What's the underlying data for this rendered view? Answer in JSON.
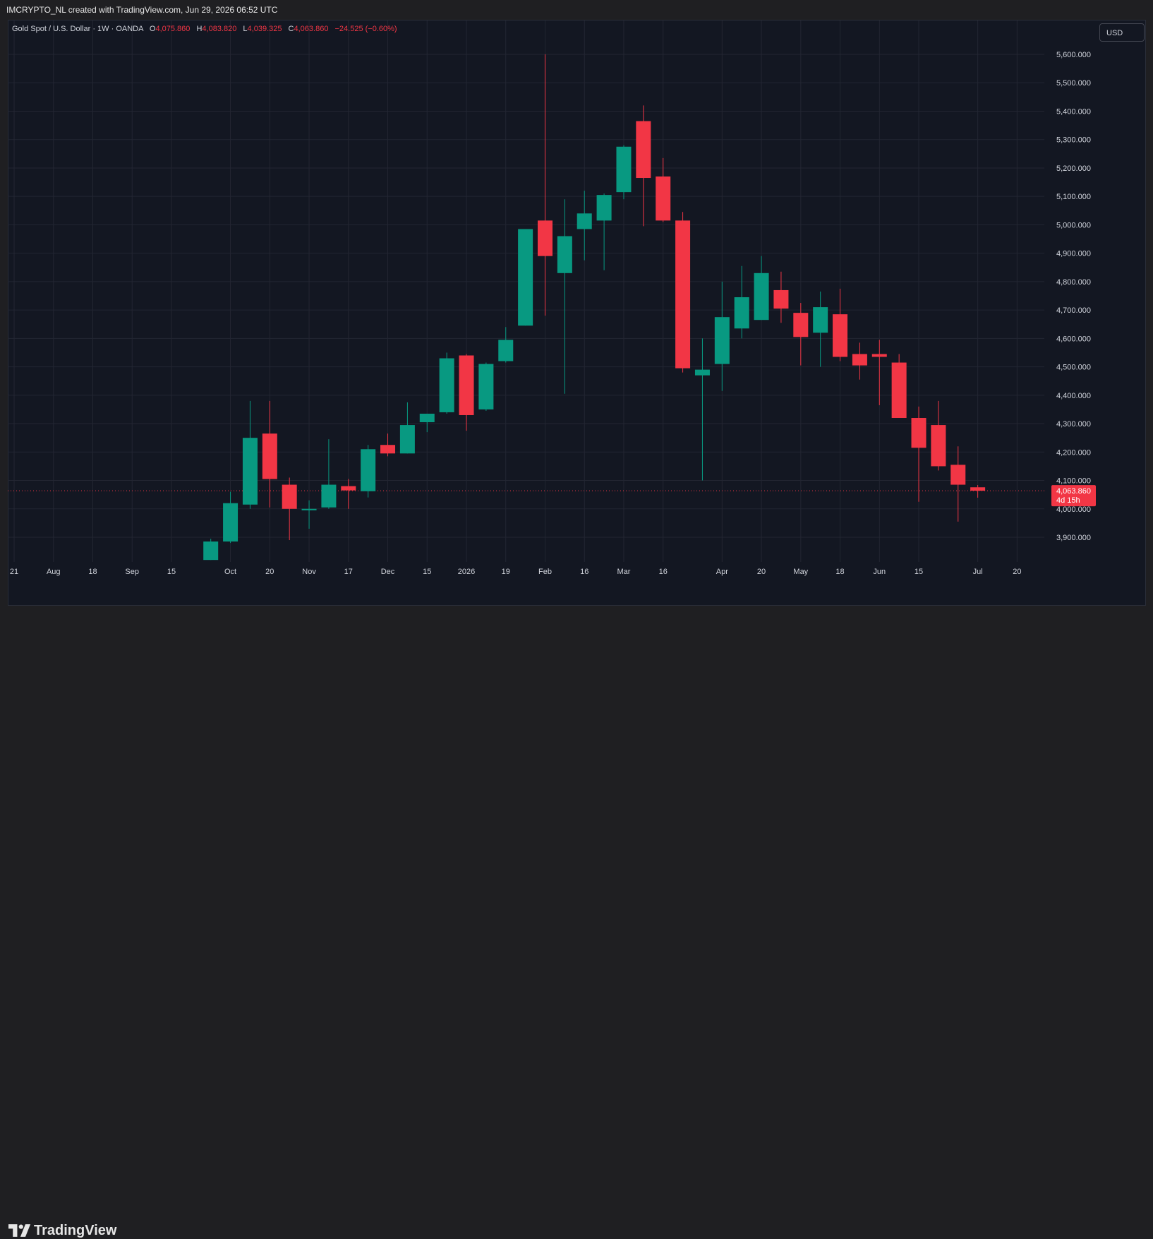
{
  "header": {
    "created_text": "IMCRYPTO_NL created with TradingView.com, Jun 29, 2026 06:52 UTC"
  },
  "legend": {
    "symbol": "Gold Spot / U.S. Dollar · 1W · OANDA",
    "open_label": "O",
    "open_value": "4,075.860",
    "high_label": "H",
    "high_value": "4,083.820",
    "low_label": "L",
    "low_value": "4,039.325",
    "close_label": "C",
    "close_value": "4,063.860",
    "change": "−24.525 (−0.60%)"
  },
  "currency_button": "USD",
  "price_tag": {
    "price": "4,063.860",
    "countdown": "4d 15h"
  },
  "footer": {
    "brand": "TradingView",
    "logo": "tradingview-logo-icon"
  },
  "colors": {
    "up": "#089981",
    "down": "#f23645",
    "background": "#131722",
    "grid": "#232632",
    "text": "#d1d4dc",
    "price_line": "#f23645"
  },
  "chart_data": {
    "type": "candlestick",
    "interval": "1W",
    "ylim": [
      3800,
      5700
    ],
    "y_ticks": [
      3900,
      4000,
      4100,
      4200,
      4300,
      4400,
      4500,
      4600,
      4700,
      4800,
      4900,
      5000,
      5100,
      5200,
      5300,
      5400,
      5500,
      5600
    ],
    "y_tick_labels": [
      "3,900.000",
      "4,000.000",
      "4,100.000",
      "4,200.000",
      "4,300.000",
      "4,400.000",
      "4,500.000",
      "4,600.000",
      "4,700.000",
      "4,800.000",
      "4,900.000",
      "5,000.000",
      "5,100.000",
      "5,200.000",
      "5,300.000",
      "5,400.000",
      "5,500.000",
      "5,600.000"
    ],
    "x_ticks": [
      {
        "label": "21",
        "week": -10
      },
      {
        "label": "Aug",
        "week": -8
      },
      {
        "label": "18",
        "week": -6
      },
      {
        "label": "Sep",
        "week": -4
      },
      {
        "label": "15",
        "week": -2
      },
      {
        "label": "Oct",
        "week": 1
      },
      {
        "label": "20",
        "week": 3
      },
      {
        "label": "Nov",
        "week": 5
      },
      {
        "label": "17",
        "week": 7
      },
      {
        "label": "Dec",
        "week": 9
      },
      {
        "label": "15",
        "week": 11
      },
      {
        "label": "2026",
        "week": 13
      },
      {
        "label": "19",
        "week": 15
      },
      {
        "label": "Feb",
        "week": 17
      },
      {
        "label": "16",
        "week": 19
      },
      {
        "label": "Mar",
        "week": 21
      },
      {
        "label": "16",
        "week": 23
      },
      {
        "label": "Apr",
        "week": 26
      },
      {
        "label": "20",
        "week": 28
      },
      {
        "label": "May",
        "week": 30
      },
      {
        "label": "18",
        "week": 32
      },
      {
        "label": "Jun",
        "week": 34
      },
      {
        "label": "15",
        "week": 36
      },
      {
        "label": "Jul",
        "week": 39
      },
      {
        "label": "20",
        "week": 41
      }
    ],
    "last_price": 4063.86,
    "candles": [
      {
        "o": 3820,
        "h": 3895,
        "l": 3820,
        "c": 3885
      },
      {
        "o": 3885,
        "h": 4060,
        "l": 3880,
        "c": 4020
      },
      {
        "o": 4015,
        "h": 4380,
        "l": 4000,
        "c": 4250
      },
      {
        "o": 4265,
        "h": 4380,
        "l": 4005,
        "c": 4105
      },
      {
        "o": 4085,
        "h": 4110,
        "l": 3890,
        "c": 4000
      },
      {
        "o": 3995,
        "h": 4030,
        "l": 3930,
        "c": 4000
      },
      {
        "o": 4005,
        "h": 4245,
        "l": 4000,
        "c": 4085
      },
      {
        "o": 4080,
        "h": 4105,
        "l": 4000,
        "c": 4065
      },
      {
        "o": 4062,
        "h": 4225,
        "l": 4040,
        "c": 4210
      },
      {
        "o": 4225,
        "h": 4265,
        "l": 4185,
        "c": 4195
      },
      {
        "o": 4195,
        "h": 4375,
        "l": 4195,
        "c": 4295
      },
      {
        "o": 4305,
        "h": 4335,
        "l": 4270,
        "c": 4335
      },
      {
        "o": 4340,
        "h": 4550,
        "l": 4335,
        "c": 4530
      },
      {
        "o": 4540,
        "h": 4545,
        "l": 4275,
        "c": 4330
      },
      {
        "o": 4350,
        "h": 4515,
        "l": 4345,
        "c": 4510
      },
      {
        "o": 4520,
        "h": 4640,
        "l": 4515,
        "c": 4595
      },
      {
        "o": 4645,
        "h": 4985,
        "l": 4645,
        "c": 4985
      },
      {
        "o": 5015,
        "h": 5600,
        "l": 4680,
        "c": 4890
      },
      {
        "o": 4830,
        "h": 5090,
        "l": 4405,
        "c": 4960
      },
      {
        "o": 4985,
        "h": 5120,
        "l": 4875,
        "c": 5040
      },
      {
        "o": 5015,
        "h": 5110,
        "l": 4840,
        "c": 5105
      },
      {
        "o": 5115,
        "h": 5280,
        "l": 5090,
        "c": 5275
      },
      {
        "o": 5365,
        "h": 5420,
        "l": 4995,
        "c": 5165
      },
      {
        "o": 5170,
        "h": 5235,
        "l": 5010,
        "c": 5015
      },
      {
        "o": 5015,
        "h": 5045,
        "l": 4480,
        "c": 4495
      },
      {
        "o": 4470,
        "h": 4600,
        "l": 4100,
        "c": 4490
      },
      {
        "o": 4510,
        "h": 4800,
        "l": 4415,
        "c": 4675
      },
      {
        "o": 4635,
        "h": 4855,
        "l": 4600,
        "c": 4745
      },
      {
        "o": 4665,
        "h": 4890,
        "l": 4665,
        "c": 4830
      },
      {
        "o": 4770,
        "h": 4835,
        "l": 4655,
        "c": 4705
      },
      {
        "o": 4690,
        "h": 4725,
        "l": 4505,
        "c": 4605
      },
      {
        "o": 4620,
        "h": 4765,
        "l": 4500,
        "c": 4710
      },
      {
        "o": 4685,
        "h": 4775,
        "l": 4520,
        "c": 4535
      },
      {
        "o": 4545,
        "h": 4585,
        "l": 4455,
        "c": 4505
      },
      {
        "o": 4545,
        "h": 4595,
        "l": 4365,
        "c": 4535
      },
      {
        "o": 4515,
        "h": 4545,
        "l": 4320,
        "c": 4320
      },
      {
        "o": 4320,
        "h": 4360,
        "l": 4025,
        "c": 4215
      },
      {
        "o": 4295,
        "h": 4380,
        "l": 4135,
        "c": 4150
      },
      {
        "o": 4155,
        "h": 4220,
        "l": 3955,
        "c": 4085
      },
      {
        "o": 4075.86,
        "h": 4083.82,
        "l": 4039.325,
        "c": 4063.86
      }
    ]
  }
}
